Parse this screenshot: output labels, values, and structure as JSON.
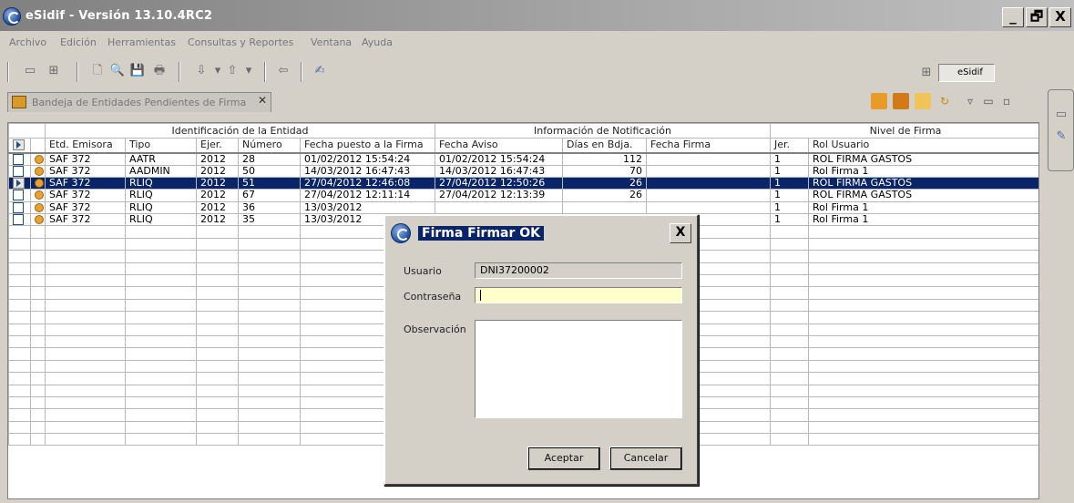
{
  "window": {
    "title": "eSidif - Versión 13.10.4RC2",
    "controls": {
      "minimize": "_",
      "restore": "🗗",
      "close": "X"
    }
  },
  "menu": [
    "Archivo",
    "Edición",
    "Herramientas",
    "Consultas y Reportes",
    "Ventana",
    "Ayuda"
  ],
  "perspective": {
    "label": "eSidif"
  },
  "view": {
    "tab_label": "Bandeja de Entidades Pendientes de Firma",
    "tab_close": "✕"
  },
  "grid": {
    "groups": {
      "identificacion": "Identificación de la Entidad",
      "notificacion": "Información de Notificación",
      "nivel": "Nivel de Firma"
    },
    "columns": [
      "Etd. Emisora",
      "Tipo",
      "Ejer.",
      "Número",
      "Fecha puesto a la Firma",
      "Fecha Aviso",
      "Días en Bdja.",
      "Fecha Firma",
      "Jer.",
      "Rol Usuario"
    ],
    "rows": [
      {
        "emisora": "SAF 372",
        "tipo": "AATR",
        "ejer": "2012",
        "numero": "28",
        "fecha_puesto": "01/02/2012 15:54:24",
        "fecha_aviso": "01/02/2012 15:54:24",
        "dias": "112",
        "fecha_firma": "",
        "jer": "1",
        "rol": "ROL FIRMA GASTOS"
      },
      {
        "emisora": "SAF 372",
        "tipo": "AADMIN",
        "ejer": "2012",
        "numero": "50",
        "fecha_puesto": "14/03/2012 16:47:43",
        "fecha_aviso": "14/03/2012 16:47:43",
        "dias": "70",
        "fecha_firma": "",
        "jer": "1",
        "rol": "Rol Firma 1"
      },
      {
        "emisora": "SAF 372",
        "tipo": "RLIQ",
        "ejer": "2012",
        "numero": "51",
        "fecha_puesto": "27/04/2012 12:46:08",
        "fecha_aviso": "27/04/2012 12:50:26",
        "dias": "26",
        "fecha_firma": "",
        "jer": "1",
        "rol": "ROL FIRMA GASTOS"
      },
      {
        "emisora": "SAF 372",
        "tipo": "RLIQ",
        "ejer": "2012",
        "numero": "67",
        "fecha_puesto": "27/04/2012 12:11:14",
        "fecha_aviso": "27/04/2012 12:13:39",
        "dias": "26",
        "fecha_firma": "",
        "jer": "1",
        "rol": "ROL FIRMA GASTOS"
      },
      {
        "emisora": "SAF 372",
        "tipo": "RLIQ",
        "ejer": "2012",
        "numero": "36",
        "fecha_puesto": "13/03/2012",
        "fecha_aviso": "",
        "dias": "",
        "fecha_firma": "",
        "jer": "1",
        "rol": "Rol Firma 1"
      },
      {
        "emisora": "SAF 372",
        "tipo": "RLIQ",
        "ejer": "2012",
        "numero": "35",
        "fecha_puesto": "13/03/2012",
        "fecha_aviso": "",
        "dias": "",
        "fecha_firma": "",
        "jer": "1",
        "rol": "Rol Firma 1"
      }
    ],
    "selected_row": 2
  },
  "dialog": {
    "title": "Firma Firmar OK",
    "close": "X",
    "usuario_label": "Usuario",
    "usuario_value": "DNI37200002",
    "password_label": "Contraseña",
    "password_value": "",
    "observacion_label": "Observación",
    "observacion_value": "",
    "accept_label": "Aceptar",
    "cancel_label": "Cancelar"
  },
  "colors": {
    "selection": "#0a246a",
    "focus_field": "#ffffcc",
    "warning_icon": "#e8a230"
  }
}
